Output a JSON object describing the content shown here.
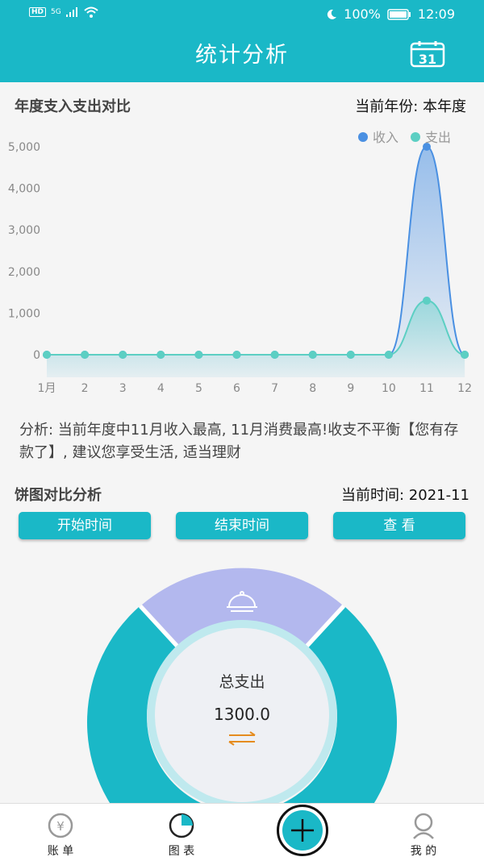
{
  "status": {
    "hd": "HD",
    "signal": "5G",
    "battery": "100%",
    "time": "12:09"
  },
  "header": {
    "title": "统计分析",
    "calendar_day": "31"
  },
  "yearly": {
    "title": "年度支入支出对比",
    "current_year_label": "当前年份: 本年度"
  },
  "chart_data": {
    "type": "area",
    "x": [
      "1月",
      "2",
      "3",
      "4",
      "5",
      "6",
      "7",
      "8",
      "9",
      "10",
      "11",
      "12"
    ],
    "yticks": [
      "0",
      "1,000",
      "2,000",
      "3,000",
      "4,000",
      "5,000"
    ],
    "ylim": [
      0,
      5000
    ],
    "series": [
      {
        "name": "收入",
        "color": "#4a90e2",
        "values": [
          0,
          0,
          0,
          0,
          0,
          0,
          0,
          0,
          0,
          0,
          5000,
          0
        ]
      },
      {
        "name": "支出",
        "color": "#5ccfc3",
        "values": [
          0,
          0,
          0,
          0,
          0,
          0,
          0,
          0,
          0,
          0,
          1300,
          0
        ]
      }
    ],
    "legend": "top-right"
  },
  "analysis": {
    "text": "分析: 当前年度中11月收入最高, 11月消费最高!收支不平衡【您有存款了】, 建议您享受生活, 适当理财"
  },
  "pie": {
    "title": "饼图对比分析",
    "current_time_label": "当前时间: 2021-11",
    "start_button": "开始时间",
    "end_button": "结束时间",
    "view_button": "查 看",
    "center_label": "总支出",
    "center_value": "1300.0",
    "colors": {
      "teal": "#1ab8c7",
      "lavender": "#b3b8ee"
    }
  },
  "tabs": {
    "bill": "账 单",
    "chart": "图 表",
    "mine": "我 的"
  }
}
